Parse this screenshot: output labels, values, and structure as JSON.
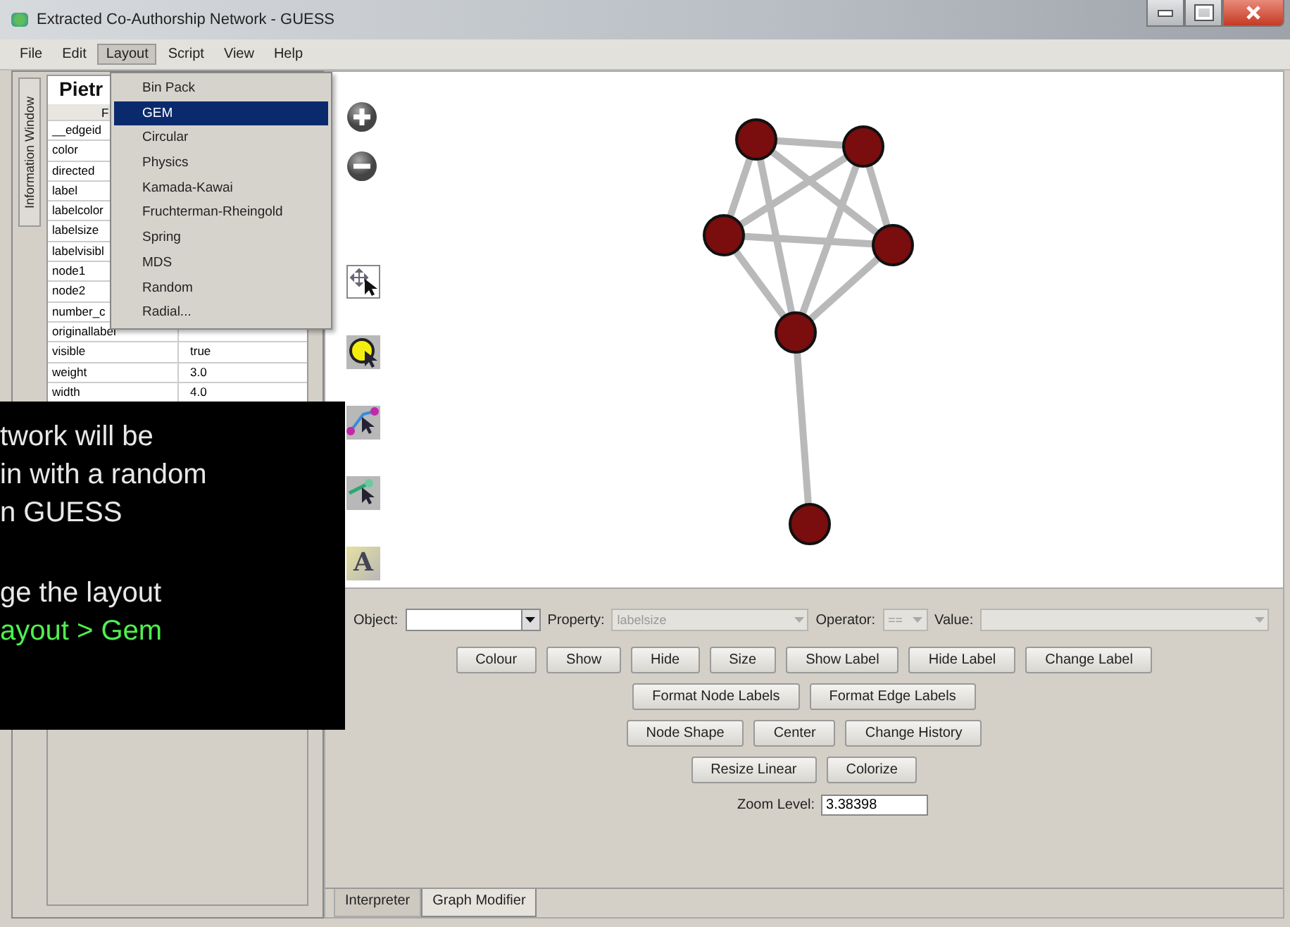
{
  "window": {
    "title": "Extracted Co-Authorship Network - GUESS"
  },
  "menu_bar": [
    {
      "label": "File",
      "open": false
    },
    {
      "label": "Edit",
      "open": false
    },
    {
      "label": "Layout",
      "open": true
    },
    {
      "label": "Script",
      "open": false
    },
    {
      "label": "View",
      "open": false
    },
    {
      "label": "Help",
      "open": false
    }
  ],
  "layout_menu": [
    {
      "label": "Bin Pack",
      "selected": false
    },
    {
      "label": "GEM",
      "selected": true
    },
    {
      "label": "Circular",
      "selected": false
    },
    {
      "label": "Physics",
      "selected": false
    },
    {
      "label": "Kamada-Kawai",
      "selected": false
    },
    {
      "label": "Fruchterman-Rheingold",
      "selected": false
    },
    {
      "label": "Spring",
      "selected": false
    },
    {
      "label": "MDS",
      "selected": false
    },
    {
      "label": "Random",
      "selected": false
    },
    {
      "label": "Radial...",
      "selected": false
    }
  ],
  "info_window": {
    "tab_label": "Information Window",
    "title": "Pietr",
    "column_1": "F",
    "rows": [
      {
        "name": "__edgeid"
      },
      {
        "name": "color"
      },
      {
        "name": "directed"
      },
      {
        "name": "label"
      },
      {
        "name": "labelcolor"
      },
      {
        "name": "labelsize"
      },
      {
        "name": "labelvisibl"
      },
      {
        "name": "node1"
      },
      {
        "name": "node2"
      },
      {
        "name": "number_c"
      },
      {
        "name": "originallabel"
      },
      {
        "name": "visible",
        "value": "true"
      },
      {
        "name": "weight",
        "value": "3.0"
      },
      {
        "name": "width",
        "value": "4.0"
      }
    ]
  },
  "canvas_tools": {
    "label_tool_glyph": "A"
  },
  "graph_modifier": {
    "fields": [
      {
        "label": "Object:",
        "disabled": false,
        "kind": "combo"
      },
      {
        "label": "Property:",
        "value": "labelsize",
        "disabled": true,
        "kind": "combo"
      },
      {
        "label": "Operator:",
        "value": "==",
        "disabled": true,
        "kind": "small"
      },
      {
        "label": "Value:",
        "disabled": true,
        "kind": "wide"
      }
    ],
    "button_rows": [
      [
        "Colour",
        "Show",
        "Hide",
        "Size",
        "Show Label",
        "Hide Label",
        "Change Label"
      ],
      [
        "Format Node Labels",
        "Format Edge Labels"
      ],
      [
        "Node Shape",
        "Center",
        "Change History"
      ],
      [
        "Resize Linear",
        "Colorize"
      ]
    ],
    "zoom_label": "Zoom Level:",
    "zoom_value": "3.38398"
  },
  "bottom_tabs": [
    {
      "label": "Interpreter",
      "selected": false
    },
    {
      "label": "Graph Modifier",
      "selected": true
    }
  ],
  "caption": {
    "paragraphs": [
      [
        {
          "text": "twork will be",
          "highlight": false
        },
        {
          "text": "in with a random",
          "highlight": false
        },
        {
          "text": "n GUESS",
          "highlight": false
        }
      ],
      [
        {
          "text": "ge the layout",
          "highlight": false
        },
        {
          "text": "ayout > Gem",
          "highlight": true
        }
      ]
    ]
  }
}
